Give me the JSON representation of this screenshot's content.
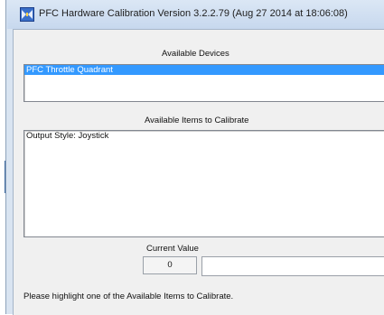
{
  "window": {
    "title": "PFC Hardware Calibration Version 3.2.2.79 (Aug 27 2014 at 18:06:08)"
  },
  "devices": {
    "label": "Available Devices",
    "items": [
      {
        "label": "PFC Throttle Quadrant",
        "selected": true
      }
    ]
  },
  "calibration_items": {
    "label": "Available Items to Calibrate",
    "items": [
      {
        "label": "Output Style: Joystick",
        "selected": false
      }
    ]
  },
  "current_value": {
    "label": "Current Value",
    "value": "0",
    "text": ""
  },
  "status": {
    "message": "Please highlight one of the Available Items to Calibrate."
  },
  "colors": {
    "selection": "#3399ff",
    "titlebar": "#c7d8ee"
  },
  "icons": {
    "app": "calibration-app-icon"
  }
}
